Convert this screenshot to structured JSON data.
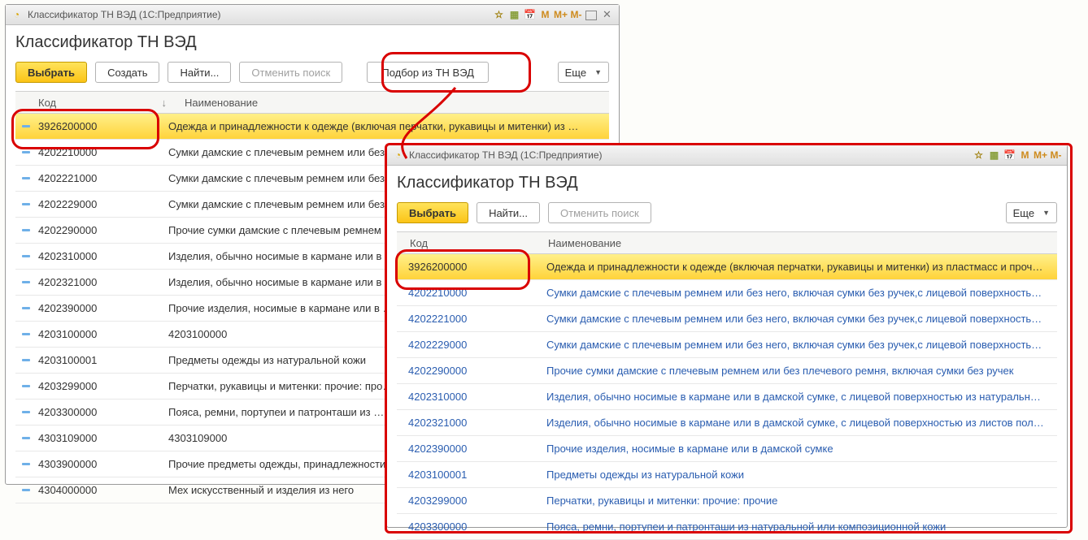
{
  "window1": {
    "title": " Классификатор ТН ВЭД  (1С:Предприятие)",
    "m": "M",
    "mp": "M+",
    "mm": "M-",
    "header": "Классификатор ТН ВЭД",
    "toolbar": {
      "select": "Выбрать",
      "create": "Создать",
      "find": "Найти...",
      "cancel": "Отменить поиск",
      "pick": "Подбор из ТН ВЭД",
      "more": "Еще"
    },
    "th": {
      "code": "Код",
      "name": "Наименование",
      "sort": "↓"
    },
    "rows": [
      {
        "code": "3926200000",
        "name": "Одежда и принадлежности к одежде (включая перчатки, рукавицы и митенки) из …",
        "sel": true
      },
      {
        "code": "4202210000",
        "name": "Сумки дамские с плечевым ремнем или без …"
      },
      {
        "code": "4202221000",
        "name": "Сумки дамские с плечевым ремнем или без …"
      },
      {
        "code": "4202229000",
        "name": "Сумки дамские с плечевым ремнем или без …"
      },
      {
        "code": "4202290000",
        "name": "Прочие сумки дамские с плечевым ремнем …"
      },
      {
        "code": "4202310000",
        "name": "Изделия, обычно носимые в кармане или в …"
      },
      {
        "code": "4202321000",
        "name": "Изделия, обычно носимые в кармане или в …"
      },
      {
        "code": "4202390000",
        "name": "Прочие изделия, носимые в кармане или в …"
      },
      {
        "code": "4203100000",
        "name": "4203100000"
      },
      {
        "code": "4203100001",
        "name": "Предметы одежды из натуральной кожи"
      },
      {
        "code": "4203299000",
        "name": "Перчатки, рукавицы и митенки: прочие: про…"
      },
      {
        "code": "4203300000",
        "name": "Пояса, ремни, портупеи и патронташи из …"
      },
      {
        "code": "4303109000",
        "name": "4303109000"
      },
      {
        "code": "4303900000",
        "name": "Прочие предметы одежды, принадлежности…"
      },
      {
        "code": "4304000000",
        "name": "Мех искусственный и изделия из него"
      }
    ]
  },
  "window2": {
    "title": " Классификатор ТН ВЭД  (1С:Предприятие)",
    "m": "M",
    "mp": "M+",
    "mm": "M-",
    "header": "Классификатор ТН ВЭД",
    "toolbar": {
      "select": "Выбрать",
      "find": "Найти...",
      "cancel": "Отменить поиск",
      "more": "Еще"
    },
    "th": {
      "code": "Код",
      "name": "Наименование"
    },
    "rows": [
      {
        "code": "3926200000",
        "name": "Одежда и принадлежности к одежде (включая перчатки, рукавицы и митенки) из пластмасс и прочи…",
        "sel": true
      },
      {
        "code": "4202210000",
        "name": "Сумки дамские с плечевым ремнем или без него, включая сумки без ручек,с лицевой поверхность…"
      },
      {
        "code": "4202221000",
        "name": "Сумки дамские с плечевым ремнем или без него, включая сумки без ручек,с лицевой поверхность…"
      },
      {
        "code": "4202229000",
        "name": "Сумки дамские с плечевым ремнем или без него, включая сумки без ручек,с лицевой поверхность…"
      },
      {
        "code": "4202290000",
        "name": "Прочие сумки дамские с плечевым ремнем или без плечевого ремня, включая сумки без ручек"
      },
      {
        "code": "4202310000",
        "name": "Изделия, обычно носимые в кармане или в дамской сумке, с лицевой поверхностью из натурально…"
      },
      {
        "code": "4202321000",
        "name": "Изделия, обычно носимые в кармане или в дамской сумке, с лицевой поверхностью из листов поли…"
      },
      {
        "code": "4202390000",
        "name": "Прочие изделия, носимые в кармане или в дамской сумке"
      },
      {
        "code": "4203100001",
        "name": "Предметы одежды из натуральной кожи"
      },
      {
        "code": "4203299000",
        "name": "Перчатки, рукавицы и митенки: прочие: прочие"
      },
      {
        "code": "4203300000",
        "name": "Пояса, ремни, портупеи и патронташи из натуральной или композиционной кожи"
      }
    ]
  }
}
